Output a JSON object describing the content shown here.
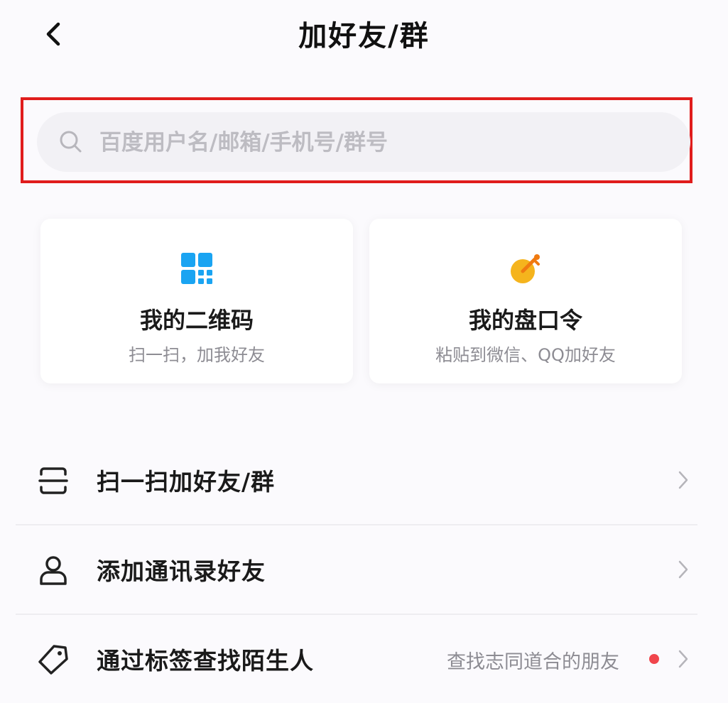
{
  "header": {
    "title": "加好友/群",
    "back_icon": "chevron-left-icon"
  },
  "search": {
    "placeholder": "百度用户名/邮箱/手机号/群号",
    "icon": "search-icon",
    "highlight_color": "#e01c1c"
  },
  "cards": [
    {
      "title": "我的二维码",
      "subtitle": "扫一扫，加我好友",
      "icon": "qr-code-icon",
      "color": "#1aa4f2"
    },
    {
      "title": "我的盘口令",
      "subtitle": "粘贴到微信、QQ加好友",
      "icon": "key-icon",
      "color": "#f5a623"
    }
  ],
  "list": [
    {
      "label": "扫一扫加好友/群",
      "icon": "scan-icon"
    },
    {
      "label": "添加通讯录好友",
      "icon": "person-icon"
    },
    {
      "label": "通过标签查找陌生人",
      "icon": "tag-icon",
      "hint": "查找志同道合的朋友",
      "has_dot": true,
      "dot_color": "#f0454c"
    }
  ]
}
